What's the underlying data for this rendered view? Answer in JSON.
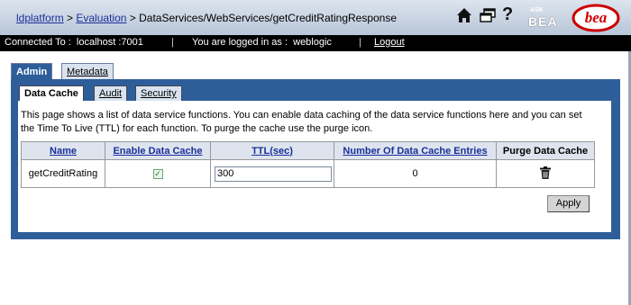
{
  "header": {
    "crumb1": "ldplatform",
    "sep1": " > ",
    "crumb2": "Evaluation",
    "sep2": " > ",
    "crumb3": "DataServices/WebServices/getCreditRatingResponse",
    "ask_label": "ASK",
    "bea_label": "BEA",
    "logo_text": "bea"
  },
  "status": {
    "connected": "Connected To :  localhost :7001",
    "sep": "|",
    "user": "You are logged in as :  weblogic",
    "logout": "Logout"
  },
  "tabs_top": [
    "Admin",
    "Metadata"
  ],
  "tabs_sub": [
    "Data Cache",
    "Audit",
    "Security"
  ],
  "description": "This page shows a list of data service functions. You can enable data caching of the data service functions here and you can set the Time To Live (TTL) for each function. To purge the cache use the purge icon.",
  "table": {
    "headers": [
      "Name",
      "Enable Data Cache",
      "TTL(sec)",
      "Number Of Data Cache Entries",
      "Purge Data Cache"
    ],
    "row": {
      "name": "getCreditRating",
      "enabled": "✓",
      "ttl": "300",
      "entries": "0"
    }
  },
  "apply_label": "Apply",
  "colors": {
    "tab_blue": "#2e5e9a",
    "link": "#1a2f9a",
    "bea_red": "#cc0000"
  }
}
